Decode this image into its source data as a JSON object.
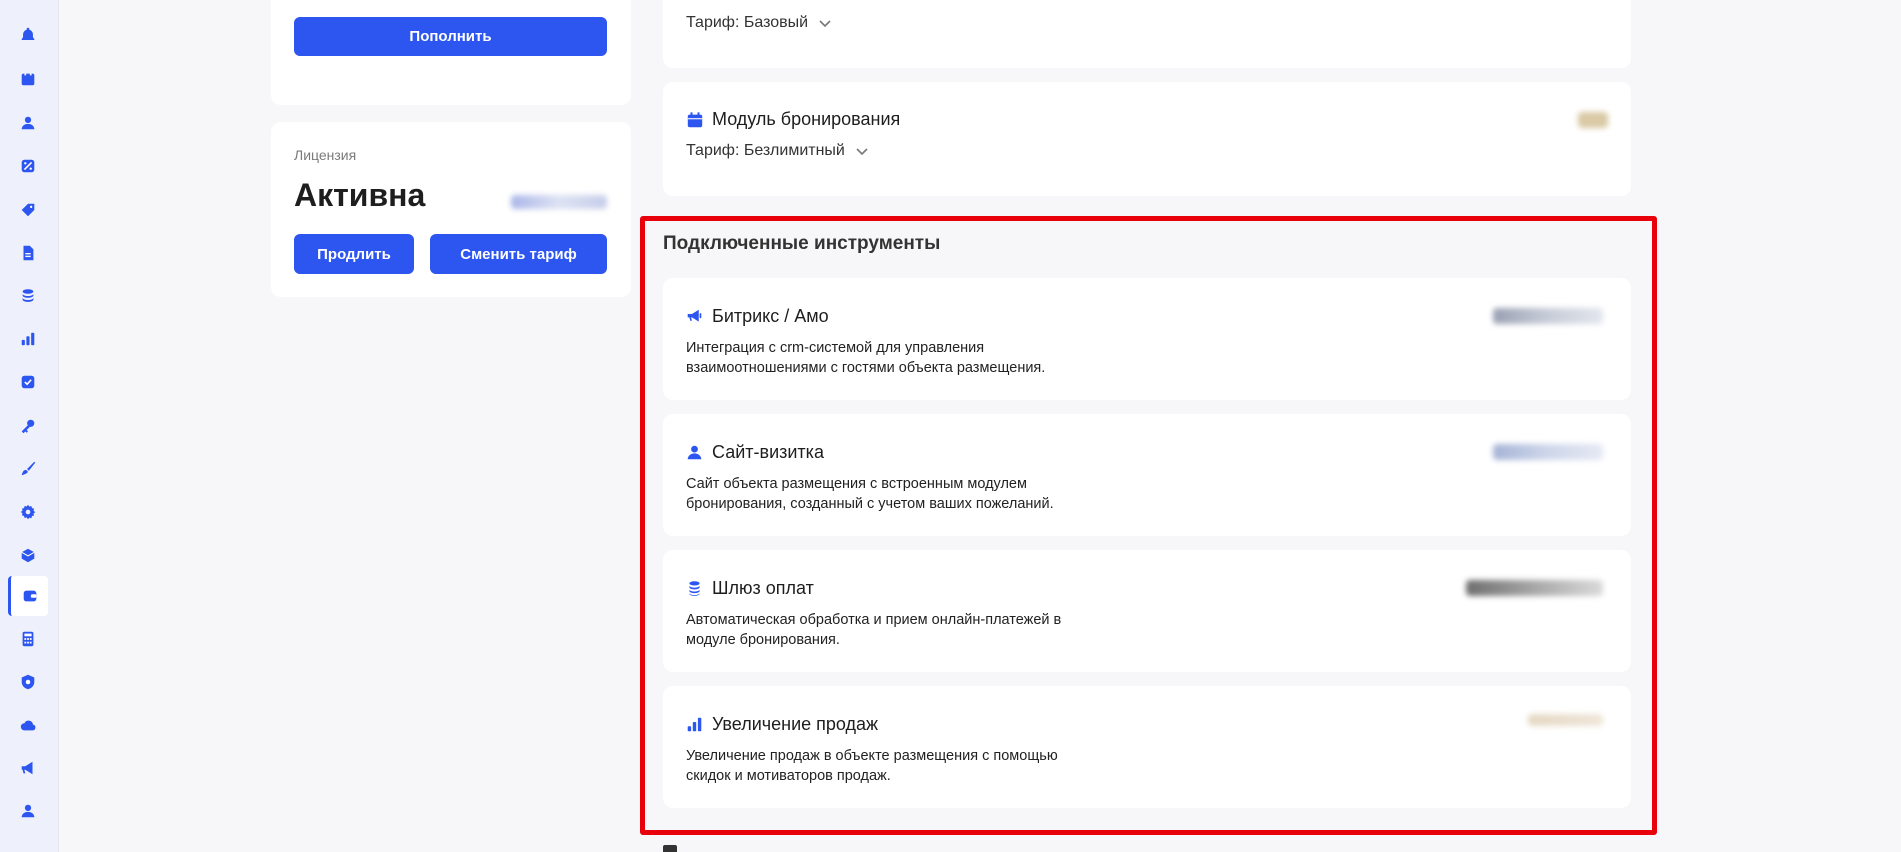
{
  "sidebar": {
    "icons": [
      "bell-icon",
      "calendar-icon",
      "user-icon",
      "percent-icon",
      "tag-icon",
      "document-icon",
      "coins-icon",
      "bar-chart-icon",
      "checkbox-icon",
      "key-icon",
      "brush-icon",
      "gear-icon",
      "box-icon",
      "wallet-icon",
      "calculator-icon",
      "badge-icon",
      "cloud-icon",
      "megaphone-icon",
      "person-icon"
    ],
    "active": "wallet-icon"
  },
  "balance": {
    "topup_label": "Пополнить"
  },
  "license": {
    "label": "Лицензия",
    "status": "Активна",
    "extend_label": "Продлить",
    "change_label": "Сменить тариф"
  },
  "modules": {
    "top": {
      "tariff": "Тариф: Базовый"
    },
    "booking": {
      "title": "Модуль бронирования",
      "tariff": "Тариф: Безлимитный"
    }
  },
  "tools": {
    "title": "Подключенные инструменты",
    "items": [
      {
        "icon": "megaphone-icon",
        "title": "Битрикс / Амо",
        "desc": "Интеграция с crm-системой для управления взаимоотношениями с гостями объекта размещения."
      },
      {
        "icon": "user-icon",
        "title": "Сайт-визитка",
        "desc": "Сайт объекта размещения с встроенным модулем бронирования, созданный с учетом ваших пожеланий."
      },
      {
        "icon": "coins-icon",
        "title": "Шлюз оплат",
        "desc": "Автоматическая обработка и прием онлайн-платежей в модуле бронирования."
      },
      {
        "icon": "bar-chart-icon",
        "title": "Увеличение продаж",
        "desc": "Увеличение продаж в объекте размещения с помощью скидок и мотиваторов продаж."
      }
    ]
  },
  "colors": {
    "accent": "#2d55f0",
    "highlight": "#e8000b"
  }
}
